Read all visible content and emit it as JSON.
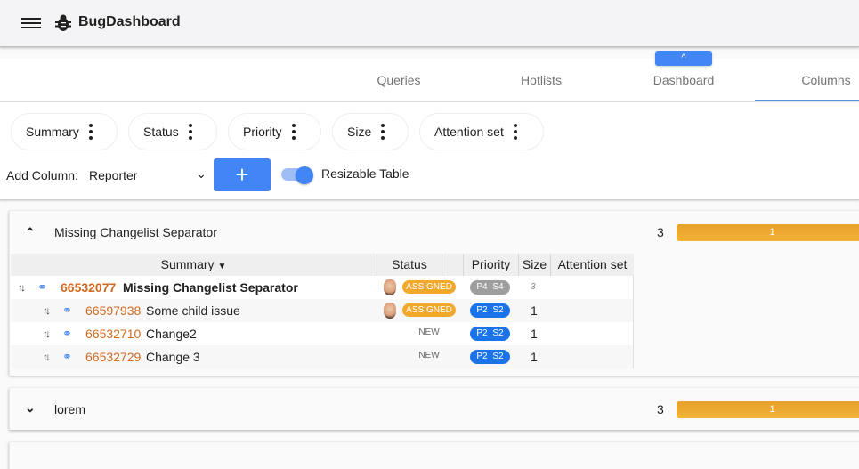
{
  "app": {
    "title": "BugDashboard"
  },
  "tabs": [
    {
      "label": "Queries",
      "active": false
    },
    {
      "label": "Hotlists",
      "active": false
    },
    {
      "label": "Dashboard",
      "active": false
    },
    {
      "label": "Columns",
      "active": true
    }
  ],
  "collapse_button": {
    "label": "^"
  },
  "columns": [
    {
      "label": "Summary"
    },
    {
      "label": "Status"
    },
    {
      "label": "Priority"
    },
    {
      "label": "Size"
    },
    {
      "label": "Attention set"
    }
  ],
  "add_column": {
    "label": "Add Column:",
    "selected": "Reporter",
    "add_button": "+"
  },
  "resizable_toggle": {
    "label": "Resizable Table",
    "on": true
  },
  "groups": [
    {
      "title": "Missing Changelist Separator",
      "expanded": true,
      "count": "3",
      "bar_label": "1",
      "table": {
        "headers": [
          "Summary",
          "Status",
          "Priority",
          "Size",
          "Attention set"
        ],
        "rows": [
          {
            "id": "66532077",
            "title": "Missing Changelist Separator",
            "status": "ASSIGNED",
            "priority": "P4 S4",
            "size": "3",
            "parent": true
          },
          {
            "id": "66597938",
            "title": "Some child issue",
            "status": "ASSIGNED",
            "priority": "P2 S2",
            "size": "1",
            "parent": false
          },
          {
            "id": "66532710",
            "title": "Change2",
            "status": "NEW",
            "priority": "P2 S2",
            "size": "1",
            "parent": false
          },
          {
            "id": "66532729",
            "title": "Change 3",
            "status": "NEW",
            "priority": "P2 S2",
            "size": "1",
            "parent": false
          }
        ]
      }
    },
    {
      "title": "lorem",
      "expanded": false,
      "count": "3",
      "bar_label": "1"
    }
  ],
  "colors": {
    "accent": "#4285f4",
    "assigned": "#f2a829",
    "bug_id": "#d1691f",
    "priority_p2": "#1a73e8",
    "priority_p4": "#9e9e9e",
    "bar": "#eaa631"
  }
}
